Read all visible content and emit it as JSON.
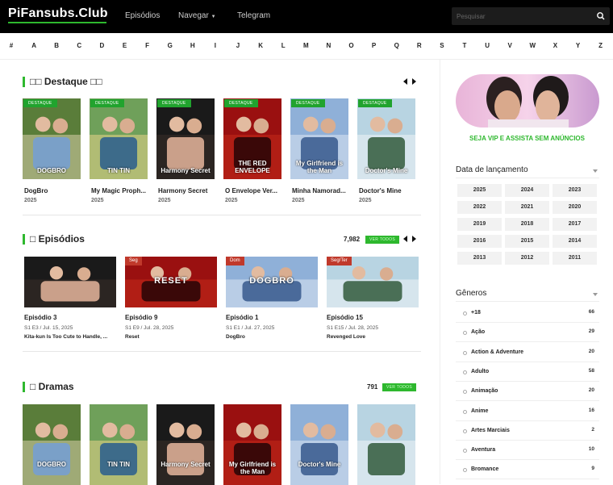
{
  "header": {
    "logo": "PiFansubs.Club",
    "nav": [
      {
        "label": "Episódios"
      },
      {
        "label": "Navegar"
      },
      {
        "label": "Telegram"
      }
    ],
    "search_placeholder": "Pesquisar"
  },
  "letters": [
    "#",
    "A",
    "B",
    "C",
    "D",
    "E",
    "F",
    "G",
    "H",
    "I",
    "J",
    "K",
    "L",
    "M",
    "N",
    "O",
    "P",
    "Q",
    "R",
    "S",
    "T",
    "U",
    "V",
    "W",
    "X",
    "Y",
    "Z"
  ],
  "featured": {
    "title": "□□ Destaque □□",
    "badge": "DESTAQUE",
    "items": [
      {
        "title": "DogBro",
        "year": "2025",
        "poster_text": "DOGBRO"
      },
      {
        "title": "My Magic Proph...",
        "year": "2025",
        "poster_text": "TIN TIN"
      },
      {
        "title": "Harmony Secret",
        "year": "2025",
        "poster_text": "Harmony Secret"
      },
      {
        "title": "O Envelope Ver...",
        "year": "2025",
        "poster_text": "THE RED ENVELOPE"
      },
      {
        "title": "Minha Namorad...",
        "year": "2025",
        "poster_text": "My Girlfriend is the Man"
      },
      {
        "title": "Doctor's Mine",
        "year": "2025",
        "poster_text": "Doctor's Mine"
      }
    ]
  },
  "episodes": {
    "title": "□ Episódios",
    "count": "7,982",
    "see_all": "VER TODOS",
    "items": [
      {
        "badge": "",
        "title": "Episódio 3",
        "meta": "S1 E3 / Jul. 15, 2025",
        "show": "Kita-kun Is Too Cute to Handle, ..."
      },
      {
        "badge": "Seg",
        "title": "Episódio 9",
        "meta": "S1 E9 / Jul. 28, 2025",
        "show": "Reset",
        "thumb_text": "RESET"
      },
      {
        "badge": "Dom",
        "title": "Episódio 1",
        "meta": "S1 E1 / Jul. 27, 2025",
        "show": "DogBro",
        "thumb_text": "DOGBRO"
      },
      {
        "badge": "Seg/Ter",
        "title": "Episódio 15",
        "meta": "S1 E15 / Jul. 28, 2025",
        "show": "Revenged Love"
      }
    ]
  },
  "dramas": {
    "title": "□ Dramas",
    "count": "791",
    "see_all": "VER TODOS",
    "items": [
      {
        "poster_text": "DOGBRO"
      },
      {
        "poster_text": "TIN TIN"
      },
      {
        "poster_text": "Harmony Secret"
      },
      {
        "poster_text": "My Girlfriend is the Man"
      },
      {
        "poster_text": "Doctor's Mine"
      },
      {
        "poster_text": ""
      }
    ]
  },
  "sidebar": {
    "vip_text": "SEJA VIP E ASSISTA SEM ANÚNCIOS",
    "release_title": "Data de lançamento",
    "years": [
      "2025",
      "2024",
      "2023",
      "2022",
      "2021",
      "2020",
      "2019",
      "2018",
      "2017",
      "2016",
      "2015",
      "2014",
      "2013",
      "2012",
      "2011"
    ],
    "genres_title": "Gêneros",
    "genres": [
      {
        "name": "+18",
        "count": "66"
      },
      {
        "name": "Ação",
        "count": "29"
      },
      {
        "name": "Action & Adventure",
        "count": "20"
      },
      {
        "name": "Adulto",
        "count": "58"
      },
      {
        "name": "Animação",
        "count": "20"
      },
      {
        "name": "Anime",
        "count": "16"
      },
      {
        "name": "Artes Marciais",
        "count": "2"
      },
      {
        "name": "Aventura",
        "count": "10"
      },
      {
        "name": "Bromance",
        "count": "9"
      }
    ]
  },
  "colors": {
    "accent": "#2eb82e",
    "badge_red": "#c0392b",
    "topbar": "#000000"
  }
}
